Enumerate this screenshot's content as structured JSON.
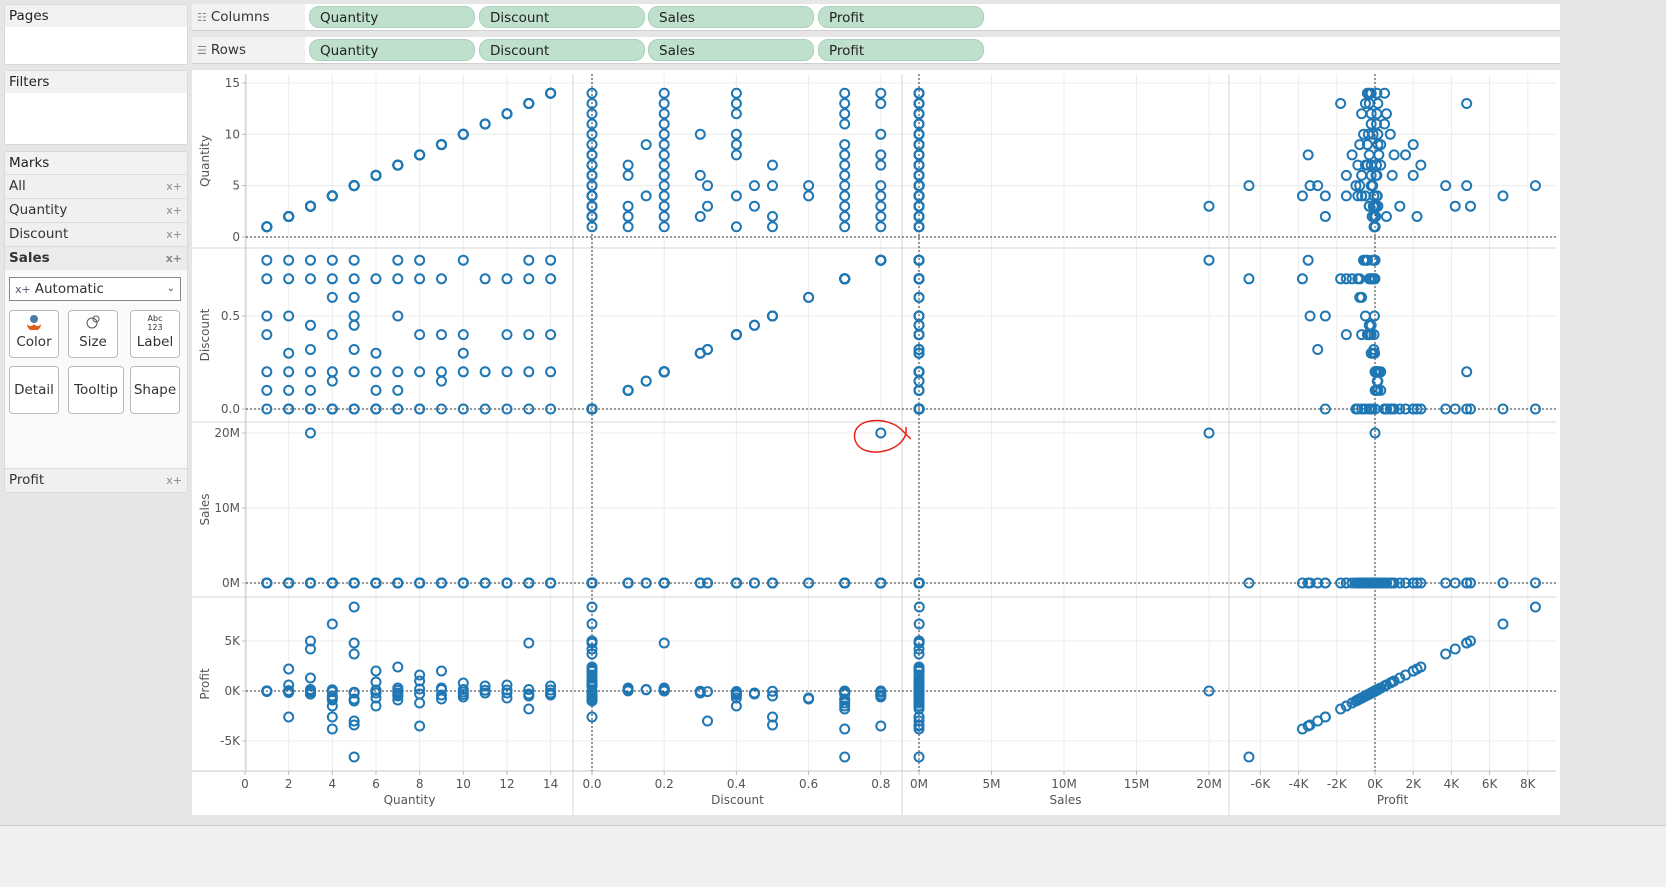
{
  "pages": {
    "title": "Pages"
  },
  "filters": {
    "title": "Filters"
  },
  "marks": {
    "title": "Marks",
    "rows": [
      {
        "label": "All",
        "icon": "x+"
      },
      {
        "label": "Quantity",
        "icon": "x+"
      },
      {
        "label": "Discount",
        "icon": "x+"
      },
      {
        "label": "Sales",
        "icon": "x+"
      }
    ],
    "mark_type": "Automatic",
    "mark_type_icon": "x+",
    "buttons": [
      "Color",
      "Size",
      "Label",
      "Detail",
      "Tooltip",
      "Shape"
    ],
    "label_icon_text": "Abc 123",
    "profit_row": {
      "label": "Profit",
      "icon": "x+"
    }
  },
  "shelves": {
    "columns": {
      "label": "Columns",
      "pills": [
        "Quantity",
        "Discount",
        "Sales",
        "Profit"
      ]
    },
    "rows": {
      "label": "Rows",
      "pills": [
        "Quantity",
        "Discount",
        "Sales",
        "Profit"
      ]
    }
  },
  "chart_data": {
    "type": "scatter",
    "layout": "scatter-plot-matrix",
    "mark_color": "#1f77b4",
    "mark_shape": "open-circle",
    "grid": true,
    "annotation": {
      "shape": "hand-drawn red circle",
      "color": "#e8201a",
      "around": {
        "quantity": 3,
        "discount": 0.8,
        "sales": 20000000,
        "profit": 0
      }
    },
    "fields": [
      {
        "name": "Quantity",
        "ticks_x": [
          [
            0,
            "0"
          ],
          [
            2,
            "2"
          ],
          [
            4,
            "4"
          ],
          [
            6,
            "6"
          ],
          [
            8,
            "8"
          ],
          [
            10,
            "10"
          ],
          [
            12,
            "12"
          ],
          [
            14,
            "14"
          ]
        ],
        "ticks_y": [
          [
            0,
            "0"
          ],
          [
            5,
            "5"
          ],
          [
            10,
            "10"
          ],
          [
            15,
            "15"
          ]
        ]
      },
      {
        "name": "Discount",
        "ticks_x": [
          [
            0,
            "0.0"
          ],
          [
            0.2,
            "0.2"
          ],
          [
            0.4,
            "0.4"
          ],
          [
            0.6,
            "0.6"
          ],
          [
            0.8,
            "0.8"
          ]
        ],
        "ticks_y": [
          [
            0,
            "0.0"
          ],
          [
            0.5,
            "0.5"
          ]
        ]
      },
      {
        "name": "Sales",
        "ticks_x": [
          [
            0,
            "0M"
          ],
          [
            5000000,
            "5M"
          ],
          [
            10000000,
            "10M"
          ],
          [
            15000000,
            "15M"
          ],
          [
            20000000,
            "20M"
          ]
        ],
        "ticks_y": [
          [
            0,
            "0M"
          ],
          [
            10000000,
            "10M"
          ],
          [
            20000000,
            "20M"
          ]
        ]
      },
      {
        "name": "Profit",
        "ticks_x": [
          [
            -6000,
            "-6K"
          ],
          [
            -4000,
            "-4K"
          ],
          [
            -2000,
            "-2K"
          ],
          [
            0,
            "0K"
          ],
          [
            2000,
            "2K"
          ],
          [
            4000,
            "4K"
          ],
          [
            6000,
            "6K"
          ],
          [
            8000,
            "8K"
          ]
        ],
        "ticks_y": [
          [
            -5000,
            "-5K"
          ],
          [
            0,
            "0K"
          ],
          [
            5000,
            "5K"
          ]
        ]
      }
    ],
    "record_fields": [
      "quantity",
      "discount",
      "sales",
      "profit"
    ],
    "records": [
      [
        1,
        0,
        16,
        5
      ],
      [
        1,
        0.2,
        30,
        3
      ],
      [
        1,
        0.7,
        5,
        -4
      ],
      [
        1,
        0.8,
        3,
        -8
      ],
      [
        1,
        0.4,
        200,
        -50
      ],
      [
        1,
        0.1,
        90,
        10
      ],
      [
        1,
        0.5,
        60,
        -30
      ],
      [
        2,
        0,
        400,
        2200
      ],
      [
        2,
        0.2,
        50,
        8
      ],
      [
        2,
        0.7,
        20,
        -30
      ],
      [
        2,
        0.8,
        10,
        -40
      ],
      [
        2,
        0.5,
        800,
        -2600
      ],
      [
        2,
        0.3,
        300,
        -20
      ],
      [
        2,
        0.1,
        150,
        40
      ],
      [
        3,
        0,
        9000,
        5000
      ],
      [
        3,
        0.2,
        300,
        40
      ],
      [
        3,
        0.7,
        60,
        -90
      ],
      [
        3,
        0.8,
        20000000,
        0
      ],
      [
        3,
        0.1,
        800,
        150
      ],
      [
        3,
        0.45,
        1200,
        -300
      ],
      [
        3,
        0.32,
        200,
        -60
      ],
      [
        4,
        0,
        12000,
        6700
      ],
      [
        4,
        0.2,
        500,
        90
      ],
      [
        4,
        0.7,
        900,
        -3800
      ],
      [
        4,
        0.8,
        40,
        -60
      ],
      [
        4,
        0.15,
        600,
        120
      ],
      [
        4,
        0.4,
        2000,
        -1500
      ],
      [
        4,
        0.6,
        500,
        -700
      ],
      [
        5,
        0,
        22000,
        8400
      ],
      [
        5,
        0.2,
        3000,
        4800
      ],
      [
        5,
        0.7,
        2500,
        -6600
      ],
      [
        5,
        0.8,
        50,
        -120
      ],
      [
        5,
        0.32,
        900,
        -3000
      ],
      [
        5,
        0.5,
        700,
        -3400
      ],
      [
        5,
        0.6,
        300,
        -800
      ],
      [
        5,
        0.45,
        400,
        -200
      ],
      [
        6,
        0,
        2000,
        900
      ],
      [
        6,
        0.2,
        400,
        50
      ],
      [
        6,
        0.7,
        800,
        -1500
      ],
      [
        6,
        0.3,
        1000,
        -200
      ],
      [
        6,
        0.1,
        500,
        100
      ],
      [
        7,
        0,
        3000,
        2400
      ],
      [
        7,
        0.2,
        600,
        80
      ],
      [
        7,
        0.7,
        500,
        -900
      ],
      [
        7,
        0.8,
        100,
        -400
      ],
      [
        7,
        0.1,
        1500,
        300
      ],
      [
        7,
        0.5,
        700,
        -500
      ],
      [
        8,
        0,
        2500,
        1000
      ],
      [
        8,
        0.2,
        700,
        200
      ],
      [
        8,
        0.7,
        600,
        -1200
      ],
      [
        8,
        0.8,
        400,
        -3500
      ],
      [
        8,
        0.4,
        900,
        -300
      ],
      [
        9,
        0,
        4000,
        2000
      ],
      [
        9,
        0.2,
        800,
        300
      ],
      [
        9,
        0.7,
        600,
        -800
      ],
      [
        9,
        0.4,
        1100,
        -400
      ],
      [
        9,
        0.15,
        700,
        150
      ],
      [
        10,
        0,
        2000,
        800
      ],
      [
        10,
        0.2,
        900,
        150
      ],
      [
        10,
        0.8,
        200,
        -600
      ],
      [
        10,
        0.3,
        700,
        -100
      ],
      [
        10,
        0.4,
        500,
        -350
      ],
      [
        11,
        0,
        1500,
        500
      ],
      [
        11,
        0.2,
        700,
        80
      ],
      [
        11,
        0.7,
        300,
        -200
      ],
      [
        12,
        0,
        1800,
        600
      ],
      [
        12,
        0.2,
        600,
        100
      ],
      [
        12,
        0.4,
        900,
        -700
      ],
      [
        12,
        0.7,
        300,
        -200
      ],
      [
        13,
        0,
        8000,
        4800
      ],
      [
        13,
        0.2,
        600,
        150
      ],
      [
        13,
        0.7,
        400,
        -1800
      ],
      [
        13,
        0.8,
        200,
        -500
      ],
      [
        13,
        0.4,
        500,
        -300
      ],
      [
        14,
        0,
        1200,
        500
      ],
      [
        14,
        0.2,
        700,
        100
      ],
      [
        14,
        0.7,
        500,
        -300
      ],
      [
        14,
        0.8,
        300,
        -400
      ],
      [
        14,
        0.4,
        600,
        -200
      ],
      [
        3,
        0,
        400,
        -300
      ],
      [
        4,
        0,
        600,
        -500
      ],
      [
        5,
        0,
        800,
        -1000
      ],
      [
        6,
        0,
        300,
        -700
      ],
      [
        2,
        0,
        200,
        -150
      ],
      [
        3,
        0,
        1200,
        1300
      ],
      [
        4,
        0,
        900,
        -2600
      ],
      [
        5,
        0,
        1500,
        3700
      ],
      [
        6,
        0,
        700,
        2000
      ],
      [
        7,
        0,
        500,
        -200
      ],
      [
        2,
        0,
        100,
        600
      ],
      [
        8,
        0,
        900,
        1600
      ],
      [
        3,
        0,
        300,
        4200
      ],
      [
        4,
        0,
        700,
        -900
      ]
    ]
  }
}
